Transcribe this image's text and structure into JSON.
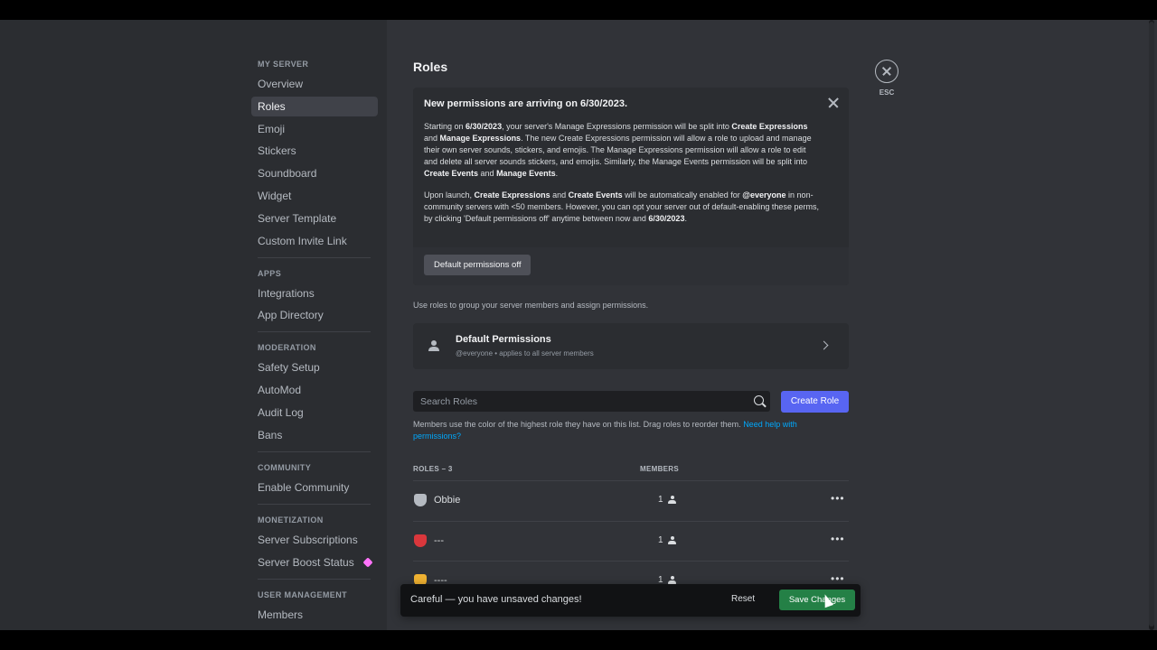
{
  "sidebar": {
    "sections": [
      {
        "heading": "MY SERVER",
        "items": [
          "Overview",
          "Roles",
          "Emoji",
          "Stickers",
          "Soundboard",
          "Widget",
          "Server Template",
          "Custom Invite Link"
        ]
      },
      {
        "heading": "APPS",
        "items": [
          "Integrations",
          "App Directory"
        ]
      },
      {
        "heading": "MODERATION",
        "items": [
          "Safety Setup",
          "AutoMod",
          "Audit Log",
          "Bans"
        ]
      },
      {
        "heading": "COMMUNITY",
        "items": [
          "Enable Community"
        ]
      },
      {
        "heading": "MONETIZATION",
        "items": [
          "Server Subscriptions",
          "Server Boost Status"
        ]
      },
      {
        "heading": "USER MANAGEMENT",
        "items": [
          "Members"
        ]
      }
    ],
    "active": "Roles"
  },
  "page_title": "Roles",
  "notice": {
    "title": "New permissions are arriving on 6/30/2023.",
    "p1": "Starting on <b>6/30/2023</b>, your server's Manage Expressions permission will be split into <b>Create Expressions</b> and <b>Manage Expressions</b>. The new Create Expressions permission will allow a role to upload and manage their own server sounds, stickers, and emojis. The Manage Expressions permission will allow a role to edit and delete all server sounds stickers, and emojis. Similarly, the Manage Events permission will be split into <b>Create Events</b> and <b>Manage Events</b>.",
    "p2": "Upon launch, <b>Create Expressions</b> and <b>Create Events</b> will be automatically enabled for <b>@everyone</b> in non-community servers with &lt;50 members. However, you can opt your server out of default-enabling these perms, by clicking 'Default permissions off' anytime between now and <b>6/30/2023</b>.",
    "button": "Default permissions off"
  },
  "description": "Use roles to group your server members and assign permissions.",
  "default_permissions": {
    "title": "Default Permissions",
    "subtitle": "@everyone • applies to all server members"
  },
  "search": {
    "placeholder": "Search Roles"
  },
  "create_role": "Create Role",
  "hint": {
    "text": "Members use the color of the highest role they have on this list. Drag roles to reorder them. ",
    "link": "Need help with permissions?"
  },
  "roles_header": {
    "roles": "ROLES – 3",
    "members": "MEMBERS"
  },
  "roles": [
    {
      "name": "Obbie",
      "members": "1",
      "color": "#b5bac1"
    },
    {
      "name": "---",
      "members": "1",
      "color": "#da373c"
    },
    {
      "name": "----",
      "members": "1",
      "color": "#f0b232"
    }
  ],
  "esc_label": "ESC",
  "unsaved": {
    "text": "Careful — you have unsaved changes!",
    "reset": "Reset",
    "save": "Save Changes"
  }
}
